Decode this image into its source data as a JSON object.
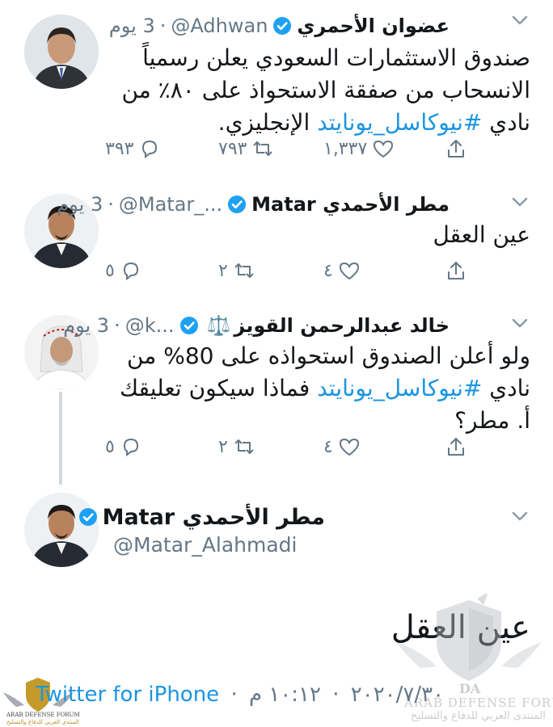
{
  "tweets": [
    {
      "name": "عضوان الأحمري",
      "handle": "@Adhwan",
      "sep": "·",
      "time": "3 يوم",
      "text_plain": "صندوق الاستثمارات السعودي يعلن رسمياً الانسحاب من صفقة الاستحواذ على ٨٠٪ من نادي ",
      "hashtag": "#نيوكاسل_يونايتد",
      "text_tail": " الإنجليزي.",
      "replies": "٣٩٣",
      "retweets": "٧٩٣",
      "likes": "١,٣٣٧"
    },
    {
      "name": "مطر الأحمدي Matar",
      "handle": "@Matar_...",
      "sep": "·",
      "time": "3 يوم",
      "text_plain": "عين العقل",
      "replies": "٥",
      "retweets": "٢",
      "likes": "٤"
    },
    {
      "name": "خالد عبدالرحمن القويز",
      "emoji": "⚖️",
      "handle": "@k...",
      "sep": "·",
      "time": "3 يوم",
      "text_plain": "ولو أعلن الصندوق استحواذه على 80% من نادي ",
      "hashtag": "#نيوكاسل_يونايتد",
      "text_tail": " فماذا سيكون تعليقك أ. مطر؟",
      "replies": "٥",
      "retweets": "٢",
      "likes": "٤"
    }
  ],
  "main_tweet": {
    "name": "مطر الأحمدي Matar",
    "handle": "@Matar_Alahmadi",
    "text": "عين العقل",
    "time": "١٠:١٢ م",
    "sep": "·",
    "date": "٢٠٢٠/٧/٣٠",
    "source": "Twitter for iPhone"
  },
  "watermark": {
    "logo": "DA",
    "title": "ARAB DEFENSE FORUM",
    "subtitle": "المنتدى العربي للدفاع والتسليح"
  },
  "colors": {
    "link": "#1b95e0",
    "muted": "#657786",
    "verified": "#1da1f2"
  }
}
